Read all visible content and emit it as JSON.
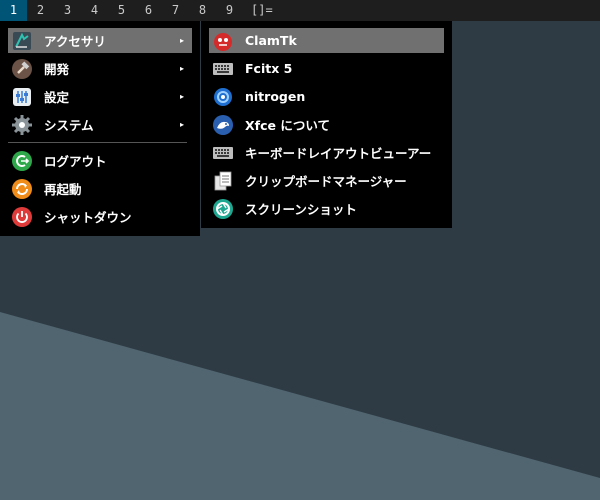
{
  "taskbar": {
    "workspaces": [
      "1",
      "2",
      "3",
      "4",
      "5",
      "6",
      "7",
      "8",
      "9"
    ],
    "layout_symbol": "[]="
  },
  "main_menu": {
    "items": [
      {
        "label": "アクセサリ",
        "icon": "accessories-icon",
        "submenu": "▸"
      },
      {
        "label": "開発",
        "icon": "hammer-icon",
        "submenu": "▸"
      },
      {
        "label": "設定",
        "icon": "settings-icon",
        "submenu": "▸"
      },
      {
        "label": "システム",
        "icon": "gear-icon",
        "submenu": "▸"
      },
      {
        "label": "ログアウト",
        "icon": "logout-icon"
      },
      {
        "label": "再起動",
        "icon": "restart-icon"
      },
      {
        "label": "シャットダウン",
        "icon": "power-icon"
      }
    ]
  },
  "submenu": {
    "items": [
      {
        "label": "ClamTk",
        "icon": "clamtk-icon"
      },
      {
        "label": "Fcitx 5",
        "icon": "keyboard-icon"
      },
      {
        "label": "nitrogen",
        "icon": "nitrogen-icon"
      },
      {
        "label": "Xfce について",
        "icon": "xfce-icon"
      },
      {
        "label": "キーボードレイアウトビューアー",
        "icon": "keyboard-icon"
      },
      {
        "label": "クリップボードマネージャー",
        "icon": "clipboard-icon"
      },
      {
        "label": "スクリーンショット",
        "icon": "camera-icon"
      }
    ]
  },
  "colors": {
    "active_workspace": "#005577",
    "menu_highlight": "#707070",
    "desktop_dark": "#2e3b44",
    "desktop_light": "#506570"
  }
}
